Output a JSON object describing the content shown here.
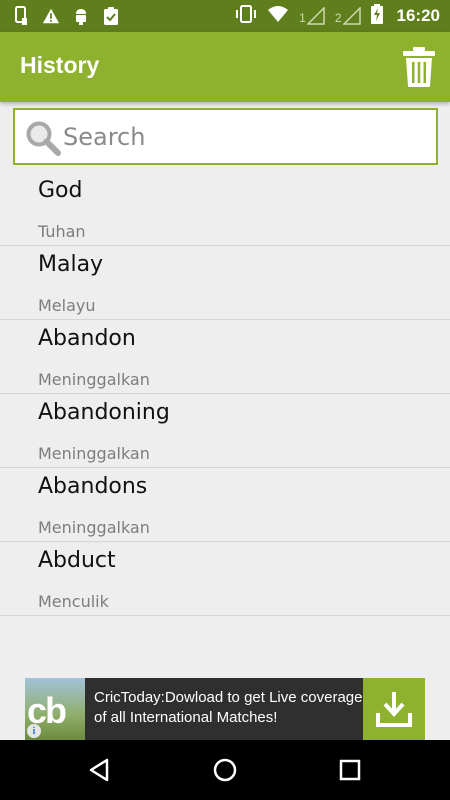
{
  "status_bar": {
    "time": "16:20",
    "sim1_label": "1",
    "sim2_label": "2"
  },
  "app_bar": {
    "title": "History",
    "color": "#8fb22e"
  },
  "search": {
    "placeholder": "Search",
    "value": ""
  },
  "history": [
    {
      "word": "God",
      "meaning": "Tuhan"
    },
    {
      "word": "Malay",
      "meaning": "Melayu"
    },
    {
      "word": "Abandon",
      "meaning": "Meninggalkan"
    },
    {
      "word": "Abandoning",
      "meaning": "Meninggalkan"
    },
    {
      "word": "Abandons",
      "meaning": "Meninggalkan"
    },
    {
      "word": "Abduct",
      "meaning": "Menculik"
    }
  ],
  "ad": {
    "logo_text": "cb",
    "info_glyph": "i",
    "text": "CricToday:Dowload to get Live coverage of all International Matches!"
  },
  "icons": {
    "trash": "trash-icon",
    "search": "search-icon",
    "download": "download-icon",
    "back": "back-icon",
    "home": "home-icon",
    "recents": "recents-icon"
  }
}
